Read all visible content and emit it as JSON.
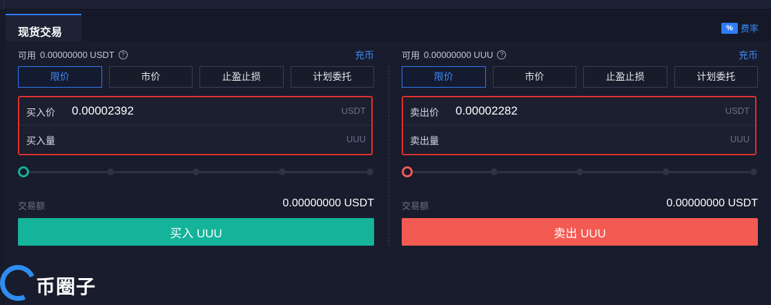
{
  "header": {
    "tab_label": "现货交易",
    "fee_icon": "%",
    "fee_label": "费率"
  },
  "buy": {
    "available_label": "可用",
    "available_value": "0.00000000 USDT",
    "recharge_label": "充币",
    "order_types": [
      "限价",
      "市价",
      "止盈止损",
      "计划委托"
    ],
    "active_order_type": 0,
    "price_label": "买入价",
    "price_value": "0.00002392",
    "price_unit": "USDT",
    "qty_label": "买入量",
    "qty_value": "",
    "qty_unit": "UUU",
    "slider_fraction": 0,
    "amount_label": "交易额",
    "amount_value": "0.00000000 USDT",
    "action_label": "买入 UUU"
  },
  "sell": {
    "available_label": "可用",
    "available_value": "0.00000000 UUU",
    "recharge_label": "充币",
    "order_types": [
      "限价",
      "市价",
      "止盈止损",
      "计划委托"
    ],
    "active_order_type": 0,
    "price_label": "卖出价",
    "price_value": "0.00002282",
    "price_unit": "USDT",
    "qty_label": "卖出量",
    "qty_value": "",
    "qty_unit": "UUU",
    "slider_fraction": 0,
    "amount_label": "交易额",
    "amount_value": "0.00000000 USDT",
    "action_label": "卖出 UUU"
  },
  "watermark": {
    "text": "币圈子"
  },
  "colors": {
    "buy": "#14b39a",
    "sell": "#f25a52",
    "accent": "#2f7cf6",
    "highlight_border": "#e0322b"
  }
}
